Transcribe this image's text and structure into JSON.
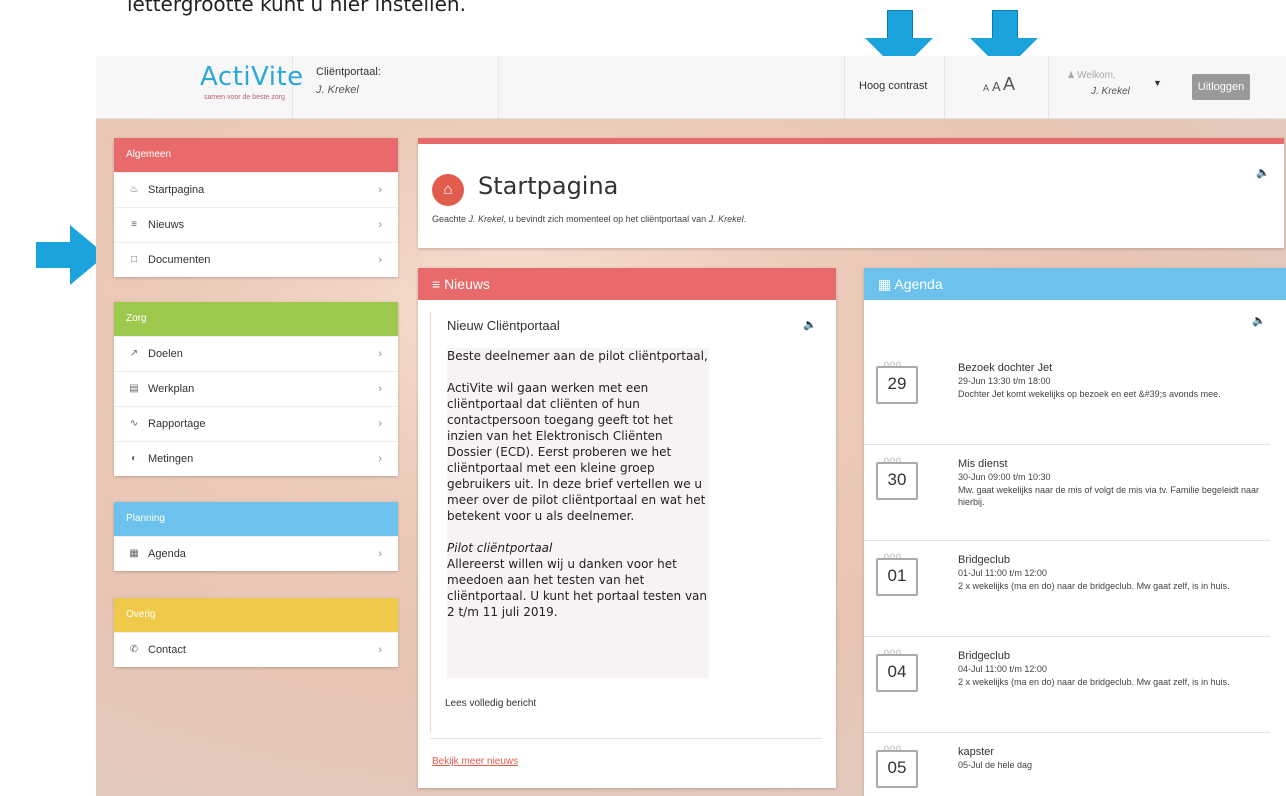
{
  "caption": "lettergrootte kunt u hier instellen.",
  "header": {
    "logo_text_a": "Acti",
    "logo_text_b": "Vite",
    "logo_tagline": "samen voor de beste zorg",
    "portal_label": "Cliëntportaal:",
    "portal_name": "J. Krekel",
    "contrast_label": "Hoog contrast",
    "font_small": "A",
    "font_medium": "A",
    "font_large": "A",
    "welcome_label": "Welkom,",
    "welcome_name": "J. Krekel",
    "logout_label": "Uitloggen"
  },
  "sidebar": {
    "groups": [
      {
        "title": "Algemeen",
        "color": "#e86a6a",
        "items": [
          "Startpagina",
          "Nieuws",
          "Documenten"
        ]
      },
      {
        "title": "Zorg",
        "color": "#9cc84b",
        "items": [
          "Doelen",
          "Werkplan",
          "Rapportage",
          "Metingen"
        ]
      },
      {
        "title": "Planning",
        "color": "#6cc2ec",
        "items": [
          "Agenda"
        ]
      },
      {
        "title": "Overig",
        "color": "#f0c94a",
        "items": [
          "Contact"
        ]
      }
    ]
  },
  "start": {
    "title": "Startpagina",
    "subtitle_pre": "Geachte ",
    "subtitle_name1": "J. Krekel",
    "subtitle_mid": ", u bevindt zich momenteel op het cliëntportaal van ",
    "subtitle_name2": "J. Krekel",
    "subtitle_post": "."
  },
  "news": {
    "header": "Nieuws",
    "item_title": "Nieuw Cliëntportaal",
    "para1": "Beste deelnemer aan de pilot cliëntportaal,",
    "para2": "ActiVite wil gaan werken met een cliëntportaal dat cliënten of hun contactpersoon toegang geeft tot het inzien van het Elektronisch Cliënten Dossier (ECD). Eerst proberen we het cliëntportaal met een kleine groep gebruikers uit. In deze brief vertellen we u meer over de pilot cliëntportaal en wat het betekent voor u als deelnemer.",
    "para3_title": "Pilot cliëntportaal",
    "para3": "Allereerst willen wij u danken voor het meedoen aan het testen van het cliëntportaal. U kunt het portaal testen van 2 t/m 11 juli 2019.",
    "read_more": "Lees volledig bericht",
    "more_news": "Bekijk meer nieuws"
  },
  "agenda": {
    "header": "Agenda",
    "events": [
      {
        "day": "29",
        "title": "Bezoek dochter Jet",
        "time": "29-Jun 13:30 t/m 18:00",
        "desc": "Dochter Jet komt wekelijks op bezoek en eet &#39;s avonds mee."
      },
      {
        "day": "30",
        "title": "Mis dienst",
        "time": "30-Jun 09:00 t/m 10:30",
        "desc": "Mw. gaat wekelijks naar de mis of volgt de mis via tv. Familie begeleidt naar hierbij."
      },
      {
        "day": "01",
        "title": "Bridgeclub",
        "time": "01-Jul 11:00 t/m 12:00",
        "desc": "2 x wekelijks (ma en do) naar de bridgeclub. Mw gaat zelf, is in huis."
      },
      {
        "day": "04",
        "title": "Bridgeclub",
        "time": "04-Jul 11:00 t/m 12:00",
        "desc": "2 x wekelijks (ma en do) naar de bridgeclub. Mw gaat zelf, is in huis."
      },
      {
        "day": "05",
        "title": "kapster",
        "time": "05-Jul de hele dag",
        "desc": ""
      }
    ]
  },
  "colors": {
    "red": "#e86a6a",
    "green": "#9cc84b",
    "blue": "#6cc2ec",
    "yellow": "#f0c94a",
    "arrow": "#1aa3dc"
  }
}
